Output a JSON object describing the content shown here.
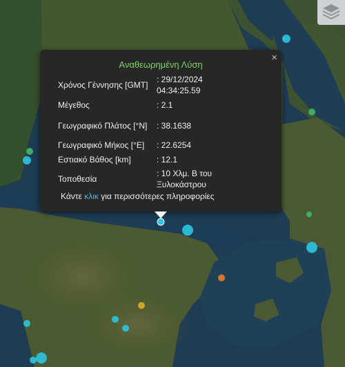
{
  "popup": {
    "title": "Αναθεωρημένη Λύση",
    "close_symbol": "×",
    "rows": [
      {
        "label": "Χρόνος Γέννησης [GMT]",
        "value": ": 29/12/2024 04:34:25.59"
      },
      {
        "label": "Μέγεθος",
        "value": ": 2.1"
      },
      {
        "label": "Γεωγραφικό Πλάτος [°N]",
        "value": ": 38.1638"
      },
      {
        "label": "Γεωγραφικό Μήκος [°E]",
        "value": ": 22.6254"
      },
      {
        "label": "Εστιακό Βάθος [km]",
        "value": ": 12.1"
      },
      {
        "label": "Τοποθεσία",
        "value": ": 10 Χλμ. Β του Ξυλοκάστρου"
      }
    ],
    "more_prefix": "Κάντε ",
    "more_link": "κλικ",
    "more_suffix": " για περισσότερες πληροφορίες",
    "title_color": "#7fd36a",
    "link_color": "#4fb3e8"
  },
  "map_controls": {
    "layers_icon": "layers-icon"
  },
  "marker_colors": {
    "cyan": "#2ec4e0",
    "green": "#3fb86a",
    "orange": "#e27a2a",
    "yellow": "#d6a62a"
  },
  "markers": [
    {
      "id": "selected",
      "color": "cyan"
    },
    {
      "id": "m1",
      "color": "cyan"
    },
    {
      "id": "m2",
      "color": "cyan"
    },
    {
      "id": "m3",
      "color": "green"
    },
    {
      "id": "m4",
      "color": "green"
    },
    {
      "id": "m5",
      "color": "cyan"
    },
    {
      "id": "m6",
      "color": "cyan"
    },
    {
      "id": "m7",
      "color": "orange"
    },
    {
      "id": "m8",
      "color": "yellow"
    },
    {
      "id": "m9",
      "color": "cyan"
    },
    {
      "id": "m10",
      "color": "cyan"
    },
    {
      "id": "m11",
      "color": "cyan"
    },
    {
      "id": "m12",
      "color": "cyan"
    },
    {
      "id": "m13",
      "color": "cyan"
    },
    {
      "id": "m14",
      "color": "green"
    }
  ]
}
